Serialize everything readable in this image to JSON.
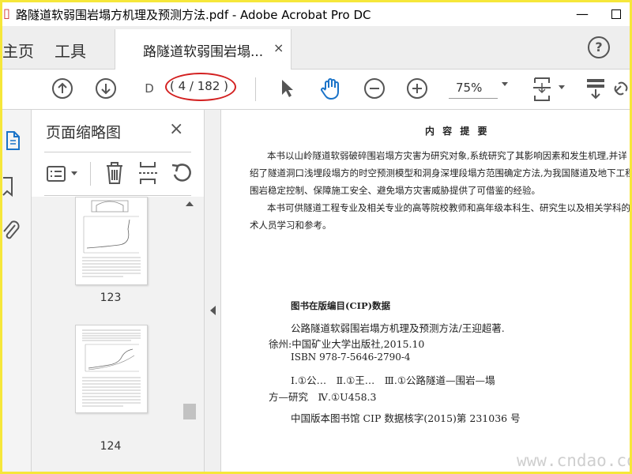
{
  "window": {
    "title": "路隧道软弱围岩塌方机理及预测方法.pdf - Adobe Acrobat Pro DC",
    "minimize_icon": "minimize-icon",
    "maximize_icon": "maximize-icon"
  },
  "tabs": {
    "home": "主页",
    "tools": "工具",
    "document": "路隧道软弱围岩塌...",
    "close": "×",
    "help": "?"
  },
  "toolbar": {
    "page_current": "D",
    "page_count": "( 4 / 182 )",
    "zoom": "75%",
    "icons": [
      "arrow-up-circle-icon",
      "arrow-down-circle-icon",
      "select-cursor-icon",
      "hand-tool-icon",
      "zoom-out-icon",
      "zoom-in-icon",
      "fit-page-icon",
      "scroll-mode-icon",
      "link-icon"
    ],
    "hand_color": "#1a73c8",
    "annotation_color": "#d32020"
  },
  "left_rail": {
    "icons": [
      "page-thumbnails-icon",
      "bookmark-icon",
      "attachment-icon"
    ]
  },
  "thumbnails_panel": {
    "title": "页面缩略图",
    "close": "×",
    "tool_icons": [
      "options-menu-icon",
      "delete-icon",
      "insert-page-icon",
      "rotate-icon"
    ],
    "pages": [
      {
        "label": "123"
      },
      {
        "label": "124"
      }
    ]
  },
  "document": {
    "heading": "内 容 提 要",
    "summary_lines": [
      "本书以山岭隧道软弱破碎围岩塌方灾害为研究对象,系统研究了其影响因素和发生机理,并详",
      "绍了隧道洞口浅埋段塌方的时空预测模型和洞身深埋段塌方范围确定方法,为我国隧道及地下工程",
      "围岩稳定控制、保障施工安全、避免塌方灾害威胁提供了可借鉴的经验。",
      "本书可供隧道工程专业及相关专业的高等院校教师和高年级本科生、研究生以及相关学科的工",
      "术人员学习和参考。"
    ],
    "cip_title": "图书在版编目(CIP)数据",
    "cip_lines": [
      "公路隧道软弱围岩塌方机理及预测方法/王迎超著.",
      "徐州:中国矿业大学出版社,2015.10",
      "ISBN 978-7-5646-2790-4",
      "Ⅰ.①公…　Ⅱ.①王…　Ⅲ.①公路隧道—围岩—塌",
      "方—研究　Ⅳ.①U458.3"
    ],
    "cip_footer": "中国版本图书馆 CIP 数据核字(2015)第 231036 号"
  },
  "watermark": "www.cndao.com"
}
